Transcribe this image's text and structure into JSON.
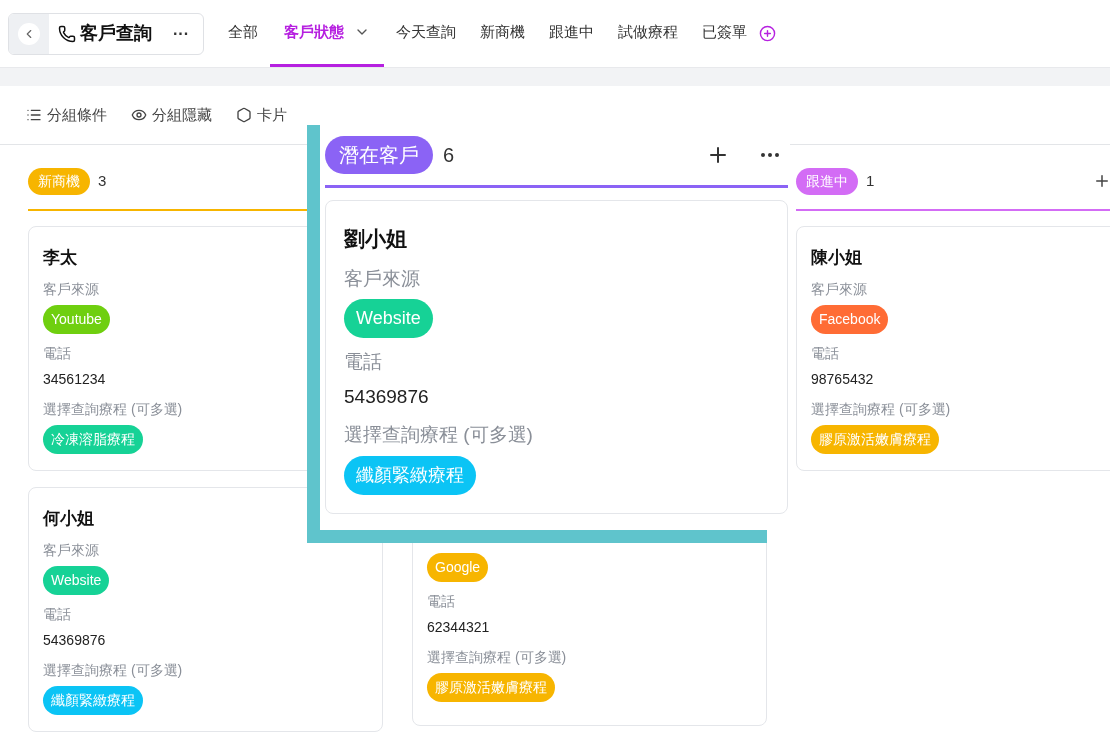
{
  "header": {
    "title": "客戶查詢",
    "more": "···"
  },
  "tabs": [
    {
      "label": "全部",
      "selected": false,
      "menu": false
    },
    {
      "label": "客戶狀態",
      "selected": true,
      "menu": true
    },
    {
      "label": "今天查詢",
      "selected": false,
      "menu": false
    },
    {
      "label": "新商機",
      "selected": false,
      "menu": false
    },
    {
      "label": "跟進中",
      "selected": false,
      "menu": false
    },
    {
      "label": "試做療程",
      "selected": false,
      "menu": false
    },
    {
      "label": "已簽單",
      "selected": false,
      "menu": false
    }
  ],
  "toolbar": [
    {
      "label": "分組條件"
    },
    {
      "label": "分組隱藏"
    },
    {
      "label": "卡片"
    }
  ],
  "columns": [
    {
      "tag": "新商機",
      "color": "#f7b500",
      "count": "3",
      "cards": [
        {
          "name": "李太",
          "source_label": "客戶來源",
          "source": {
            "text": "Youtube",
            "color": "#6fcf0f"
          },
          "phone_label": "電話",
          "phone": "34561234",
          "treatment_label": "選擇查詢療程 (可多選)",
          "treatment": {
            "text": "冷凍溶脂療程",
            "color": "#16d296"
          }
        },
        {
          "name": "何小姐",
          "source_label": "客戶來源",
          "source": {
            "text": "Website",
            "color": "#16d296"
          },
          "phone_label": "電話",
          "phone": "54369876",
          "treatment_label": "選擇查詢療程 (可多選)",
          "treatment": {
            "text": "纖顏緊緻療程",
            "color": "#0bc4f5"
          }
        }
      ]
    },
    {
      "cards": [
        {
          "source": {
            "text": "Google",
            "color": "#f7b500"
          },
          "phone_label": "電話",
          "phone": "62344321",
          "treatment_label": "選擇查詢療程 (可多選)",
          "treatment": {
            "text": "膠原激活嫩膚療程",
            "color": "#f7b500"
          }
        }
      ]
    },
    {
      "tag": "跟進中",
      "color": "#d36cf5",
      "count": "1",
      "add": true,
      "cards": [
        {
          "name": "陳小姐",
          "source_label": "客戶來源",
          "source": {
            "text": "Facebook",
            "color": "#ff6c35"
          },
          "phone_label": "電話",
          "phone": "98765432",
          "treatment_label": "選擇查詢療程 (可多選)",
          "treatment": {
            "text": "膠原激活嫩膚療程",
            "color": "#f7b500"
          }
        }
      ]
    }
  ],
  "dragged_column": {
    "tag": "潛在客戶",
    "color": "#8b63f5",
    "count": "6",
    "cards": [
      {
        "name": "劉小姐",
        "source_label": "客戶來源",
        "source": {
          "text": "Website",
          "color": "#16d296"
        },
        "phone_label": "電話",
        "phone": "54369876",
        "treatment_label": "選擇查詢療程 (可多選)",
        "treatment": {
          "text": "纖顏緊緻療程",
          "color": "#0bc4f5"
        }
      }
    ]
  }
}
